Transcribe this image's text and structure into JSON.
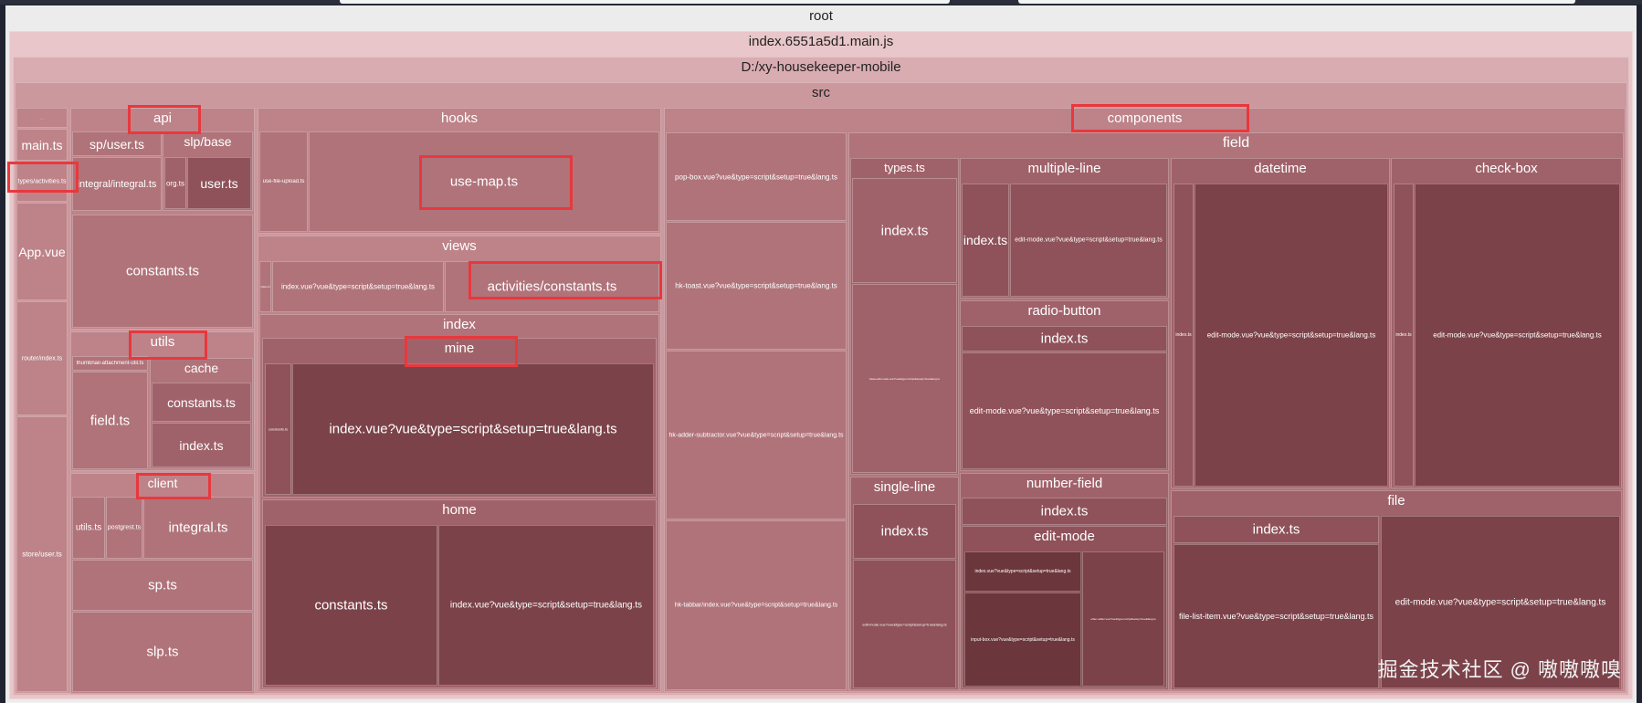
{
  "root": "root",
  "bundle": "index.6551a5d1.main.js",
  "project": "D:/xy-housekeeper-mobile",
  "src": "src",
  "left": {
    "tiny": "…",
    "main": "main.ts",
    "types_activities": "types/activities.ts",
    "app": "App.vue",
    "router": "router/index.ts",
    "store": "store/user.ts"
  },
  "api": {
    "title": "api",
    "sp_user": "sp/user.ts",
    "slp_base": "slp/base",
    "integral": "integral/integral.ts",
    "org": "org.ts",
    "user": "user.ts",
    "constants": "constants.ts"
  },
  "utils": {
    "title": "utils",
    "thumbnail": "thumbnail-attachment-util.ts",
    "field": "field.ts",
    "cache": "cache",
    "constants": "constants.ts",
    "index": "index.ts"
  },
  "client": {
    "title": "client",
    "utils": "utils.ts",
    "postgrest": "postgrest.ts",
    "integral": "integral.ts",
    "sp": "sp.ts",
    "slp": "slp.ts"
  },
  "hooks": {
    "title": "hooks",
    "file_upload": "use-file-upload.ts",
    "use_map": "use-map.ts"
  },
  "views": {
    "title": "views",
    "dot": "index.ts",
    "index_vue": "index.vue?vue&type=script&setup=true&lang.ts",
    "activities_constants": "activities/constants.ts"
  },
  "index": {
    "title": "index",
    "mine": "mine",
    "mine_constants": "constants.ts",
    "mine_index": "index.vue?vue&type=script&setup=true&lang.ts",
    "home": "home",
    "home_constants": "constants.ts",
    "home_index": "index.vue?vue&type=script&setup=true&lang.ts"
  },
  "components": {
    "title": "components",
    "pop_box": "pop-box.vue?vue&type=script&setup=true&lang.ts",
    "hk_toast": "hk-toast.vue?vue&type=script&setup=true&lang.ts",
    "hk_adder": "hk-adder-subtractor.vue?vue&type=script&setup=true&lang.ts",
    "hk_tabbar": "hk-tabbar/index.vue?vue&type=script&setup=true&lang.ts"
  },
  "field": {
    "title": "field",
    "types": "types.ts",
    "types_index": "index.ts",
    "types_base": "base-edit-mode.vue?vue&type=script&setup=true&lang.ts",
    "single_line": "single-line",
    "single_index": "index.ts",
    "single_edit": "edit-mode.vue?vue&type=script&setup=true&lang.ts",
    "multiple_line": "multiple-line",
    "ml_index": "index.ts",
    "ml_edit": "edit-mode.vue?vue&type=script&setup=true&lang.ts",
    "radio_button": "radio-button",
    "rb_index": "index.ts",
    "rb_edit": "edit-mode.vue?vue&type=script&setup=true&lang.ts",
    "number_field": "number-field",
    "nf_index": "index.ts",
    "edit_mode": "edit-mode",
    "em_index": "index.vue?vue&type=script&setup=true&lang.ts",
    "em_input": "input-box.vue?vue&type=script&setup=true&lang.ts",
    "em_other": "other-adder.vue?vue&type=script&setup=true&lang.ts",
    "datetime": "datetime",
    "dt_index": "index.ts",
    "dt_edit": "edit-mode.vue?vue&type=script&setup=true&lang.ts",
    "check_box": "check-box",
    "cb_index": "index.ts",
    "cb_edit": "edit-mode.vue?vue&type=script&setup=true&lang.ts",
    "file": "file",
    "file_index": "index.ts",
    "file_list": "file-list-item.vue?vue&type=script&setup=true&lang.ts",
    "file_edit": "edit-mode.vue?vue&type=script&setup=true&lang.ts"
  },
  "watermark": "掘金技术社区 @ 嗷嗷嗷嗅",
  "colors": {
    "highlight": "#e8383d",
    "background": "#1f2430"
  }
}
